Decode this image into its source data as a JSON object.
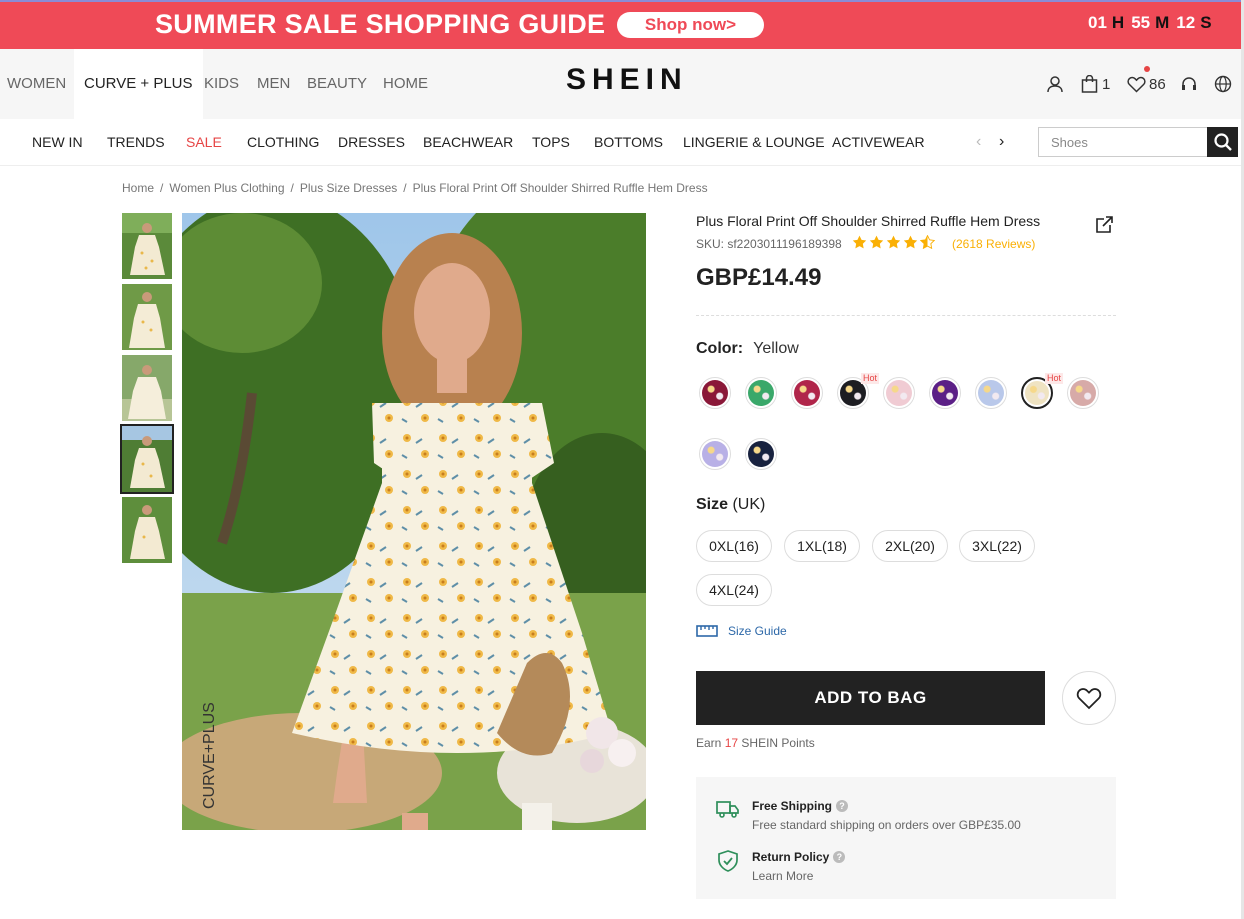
{
  "banner": {
    "title": "SUMMER SALE SHOPPING GUIDE",
    "cta": "Shop now>",
    "countdown": {
      "h": "01",
      "h_unit": "H",
      "m": "55",
      "m_unit": "M",
      "s": "12",
      "s_unit": "S"
    }
  },
  "top_nav": {
    "categories": [
      "WOMEN",
      "CURVE + PLUS",
      "KIDS",
      "MEN",
      "BEAUTY",
      "HOME"
    ],
    "active": "CURVE + PLUS",
    "logo": "SHEIN",
    "cart_count": "1",
    "wishlist_count": "86"
  },
  "nav": {
    "items": [
      "NEW IN",
      "TRENDS",
      "SALE",
      "CLOTHING",
      "DRESSES",
      "BEACHWEAR",
      "TOPS",
      "BOTTOMS",
      "LINGERIE & LOUNGE",
      "ACTIVEWEAR"
    ],
    "prev_arrow": "‹",
    "next_arrow": "›",
    "search_placeholder": "Shoes"
  },
  "breadcrumb": [
    "Home",
    "Women Plus Clothing",
    "Plus Size Dresses",
    "Plus Floral Print Off Shoulder Shirred Ruffle Hem Dress"
  ],
  "gallery": {
    "thumb_count": 5,
    "selected_index": 3,
    "image_watermark": "CURVE+PLUS"
  },
  "product": {
    "title": "Plus Floral Print Off Shoulder Shirred Ruffle Hem Dress",
    "sku": "SKU: sf2203011196189398",
    "rating": 4.5,
    "reviews": "(2618 Reviews)",
    "price": "GBP£14.49",
    "color_label": "Color:",
    "color_value": "Yellow",
    "colors": [
      {
        "name": "burgundy-floral",
        "hex": "#8a1838",
        "hot": false
      },
      {
        "name": "green-floral",
        "hex": "#3aa86a",
        "hot": false
      },
      {
        "name": "red-floral",
        "hex": "#b0254a",
        "hot": false
      },
      {
        "name": "black-floral",
        "hex": "#1d1d22",
        "hot": true
      },
      {
        "name": "pink-floral",
        "hex": "#f0cbd3",
        "hot": false
      },
      {
        "name": "purple-floral",
        "hex": "#5b1f86",
        "hot": false
      },
      {
        "name": "blue-white-floral",
        "hex": "#b9c8ea",
        "hot": false
      },
      {
        "name": "yellow-floral",
        "hex": "#efe3c2",
        "hot": true,
        "selected": true
      },
      {
        "name": "blush-floral",
        "hex": "#d7aaa8",
        "hot": false
      },
      {
        "name": "lavender-floral",
        "hex": "#b8b0e6",
        "hot": false
      },
      {
        "name": "navy-floral",
        "hex": "#18223f",
        "hot": false
      }
    ],
    "hot_label": "Hot",
    "size_label": "Size",
    "size_unit": "(UK)",
    "sizes": [
      "0XL(16)",
      "1XL(18)",
      "2XL(20)",
      "3XL(22)",
      "4XL(24)"
    ],
    "size_guide": "Size Guide",
    "add_to_bag": "ADD TO BAG",
    "points_prefix": "Earn",
    "points": "17",
    "points_suffix": "SHEIN Points"
  },
  "shipping": {
    "free_title": "Free Shipping",
    "free_desc": "Free standard shipping on orders over GBP£35.00",
    "return_title": "Return Policy",
    "return_desc": "Learn More"
  },
  "colors": {
    "banner": "#ef4a57",
    "accent_red": "#e64545",
    "star": "#fab005",
    "dark": "#222222"
  }
}
